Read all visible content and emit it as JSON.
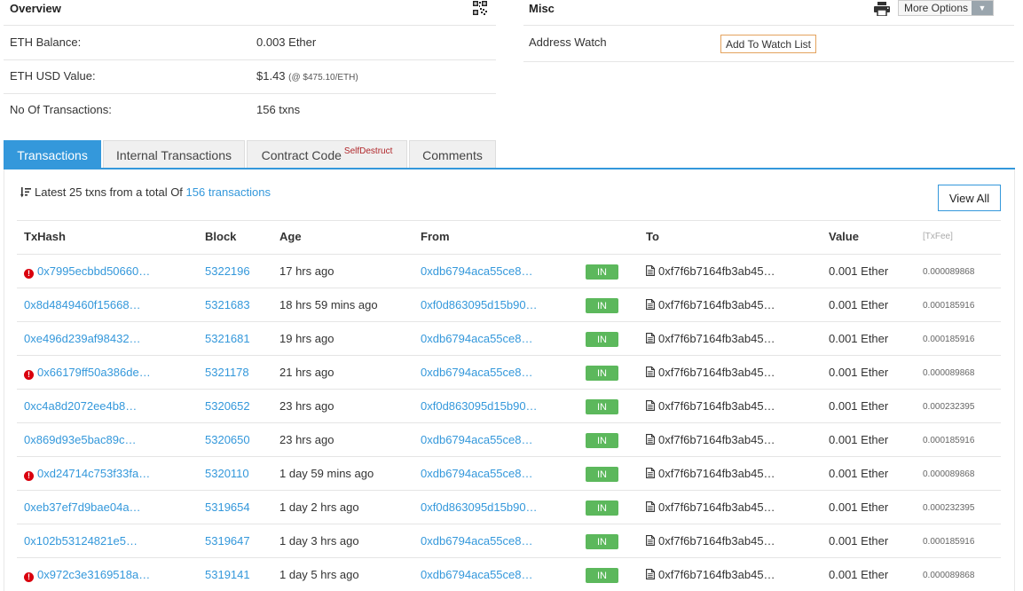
{
  "overview": {
    "title": "Overview",
    "rows": [
      {
        "label": "ETH Balance:",
        "value": "0.003 Ether",
        "extra": ""
      },
      {
        "label": "ETH USD Value:",
        "value": "$1.43",
        "extra": "(@ $475.10/ETH)"
      },
      {
        "label": "No Of Transactions:",
        "value": "156 txns",
        "extra": ""
      }
    ]
  },
  "misc": {
    "title": "Misc",
    "more_options_label": "More Options",
    "address_watch_label": "Address Watch",
    "watch_button_label": "Add To Watch List"
  },
  "tabs": [
    {
      "label": "Transactions",
      "badge": "",
      "active": true
    },
    {
      "label": "Internal Transactions",
      "badge": "",
      "active": false
    },
    {
      "label": "Contract Code",
      "badge": "SelfDestruct",
      "active": false
    },
    {
      "label": "Comments",
      "badge": "",
      "active": false
    }
  ],
  "summary": {
    "prefix": "Latest 25 txns from a total Of",
    "link": "156 transactions"
  },
  "view_all_label": "View All",
  "table": {
    "headers": [
      "TxHash",
      "Block",
      "Age",
      "From",
      "To",
      "Value",
      "[TxFee]"
    ],
    "rows": [
      {
        "error": true,
        "hash": "0x7995ecbbd50660…",
        "block": "5322196",
        "age": "17 hrs ago",
        "from": "0xdb6794aca55ce8…",
        "dir": "IN",
        "to": "0xf7f6b7164fb3ab45…",
        "value": "0.001 Ether",
        "fee": "0.000089868"
      },
      {
        "error": false,
        "hash": "0x8d4849460f15668…",
        "block": "5321683",
        "age": "18 hrs 59 mins ago",
        "from": "0xf0d863095d15b90…",
        "dir": "IN",
        "to": "0xf7f6b7164fb3ab45…",
        "value": "0.001 Ether",
        "fee": "0.000185916"
      },
      {
        "error": false,
        "hash": "0xe496d239af98432…",
        "block": "5321681",
        "age": "19 hrs ago",
        "from": "0xdb6794aca55ce8…",
        "dir": "IN",
        "to": "0xf7f6b7164fb3ab45…",
        "value": "0.001 Ether",
        "fee": "0.000185916"
      },
      {
        "error": true,
        "hash": "0x66179ff50a386de…",
        "block": "5321178",
        "age": "21 hrs ago",
        "from": "0xdb6794aca55ce8…",
        "dir": "IN",
        "to": "0xf7f6b7164fb3ab45…",
        "value": "0.001 Ether",
        "fee": "0.000089868"
      },
      {
        "error": false,
        "hash": "0xc4a8d2072ee4b8…",
        "block": "5320652",
        "age": "23 hrs ago",
        "from": "0xf0d863095d15b90…",
        "dir": "IN",
        "to": "0xf7f6b7164fb3ab45…",
        "value": "0.001 Ether",
        "fee": "0.000232395"
      },
      {
        "error": false,
        "hash": "0x869d93e5bac89c…",
        "block": "5320650",
        "age": "23 hrs ago",
        "from": "0xdb6794aca55ce8…",
        "dir": "IN",
        "to": "0xf7f6b7164fb3ab45…",
        "value": "0.001 Ether",
        "fee": "0.000185916"
      },
      {
        "error": true,
        "hash": "0xd24714c753f33fa…",
        "block": "5320110",
        "age": "1 day 59 mins ago",
        "from": "0xdb6794aca55ce8…",
        "dir": "IN",
        "to": "0xf7f6b7164fb3ab45…",
        "value": "0.001 Ether",
        "fee": "0.000089868"
      },
      {
        "error": false,
        "hash": "0xeb37ef7d9bae04a…",
        "block": "5319654",
        "age": "1 day 2 hrs ago",
        "from": "0xf0d863095d15b90…",
        "dir": "IN",
        "to": "0xf7f6b7164fb3ab45…",
        "value": "0.001 Ether",
        "fee": "0.000232395"
      },
      {
        "error": false,
        "hash": "0x102b53124821e5…",
        "block": "5319647",
        "age": "1 day 3 hrs ago",
        "from": "0xdb6794aca55ce8…",
        "dir": "IN",
        "to": "0xf7f6b7164fb3ab45…",
        "value": "0.001 Ether",
        "fee": "0.000185916"
      },
      {
        "error": true,
        "hash": "0x972c3e3169518a…",
        "block": "5319141",
        "age": "1 day 5 hrs ago",
        "from": "0xdb6794aca55ce8…",
        "dir": "IN",
        "to": "0xf7f6b7164fb3ab45…",
        "value": "0.001 Ether",
        "fee": "0.000089868"
      }
    ]
  },
  "colors": {
    "accent": "#3498db",
    "in_badge": "#5cb85c",
    "error": "#d9000d",
    "watch_border": "#e4a35e",
    "self_destruct": "#b0272b"
  },
  "icons": {
    "qr": "qr-code-icon",
    "print": "printer-icon",
    "sort": "sort-amount-icon",
    "error": "exclamation-circle-icon",
    "contract": "file-document-icon"
  }
}
